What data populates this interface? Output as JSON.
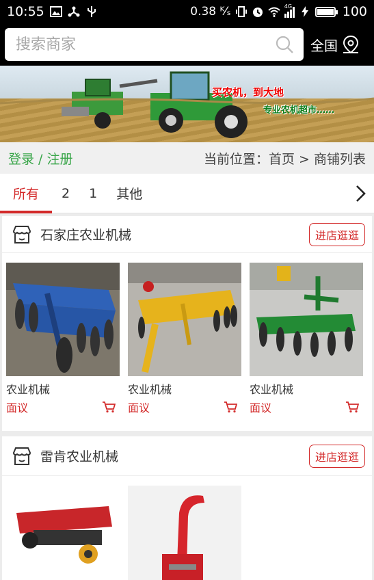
{
  "status_bar": {
    "time": "10:55",
    "speed": "0.38 ᴷ⁄ₛ",
    "network": "4G",
    "battery": "100"
  },
  "search": {
    "placeholder": "搜索商家"
  },
  "region": {
    "label": "全国"
  },
  "banner": {
    "slogan_main": "买农机，到大地",
    "slogan_sub": "专业农机超市……"
  },
  "crumbbar": {
    "login": "登录 / 注册",
    "location": "当前位置：首页 > 商铺列表"
  },
  "tabs": [
    {
      "label": "所有",
      "active": true
    },
    {
      "label": "2"
    },
    {
      "label": "1"
    },
    {
      "label": "其他"
    }
  ],
  "shops": [
    {
      "name": "石家庄农业机械",
      "visit_label": "进店逛逛",
      "products": [
        {
          "name": "农业机械",
          "price": "面议"
        },
        {
          "name": "农业机械",
          "price": "面议"
        },
        {
          "name": "农业机械",
          "price": "面议"
        }
      ]
    },
    {
      "name": "雷肯农业机械",
      "visit_label": "进店逛逛",
      "products": []
    }
  ],
  "colors": {
    "accent": "#d32a2a",
    "login": "#3aa64a",
    "header": "#000000"
  }
}
